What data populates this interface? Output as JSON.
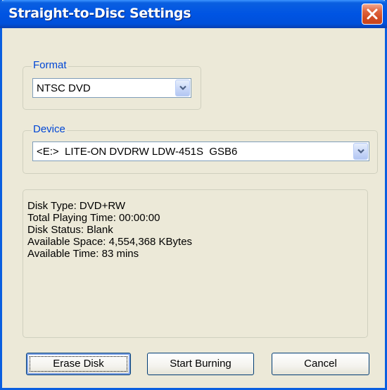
{
  "window": {
    "title": "Straight-to-Disc Settings",
    "close_icon": "close-x-icon"
  },
  "format": {
    "label": "Format",
    "value": "NTSC DVD"
  },
  "device": {
    "label": "Device",
    "value": "<E:>  LITE-ON DVDRW LDW-451S  GSB6"
  },
  "disk_info": {
    "lines": [
      "Disk Type: DVD+RW",
      "Total Playing Time: 00:00:00",
      "Disk Status: Blank",
      "Available Space: 4,554,368 KBytes",
      "Available Time: 83 mins"
    ]
  },
  "buttons": {
    "erase": "Erase Disk",
    "burn": "Start Burning",
    "cancel": "Cancel"
  },
  "colors": {
    "titlebar": "#0054E3",
    "close_button": "#D14B22",
    "group_label": "#0046D5",
    "window_bg": "#ECE9D8"
  }
}
